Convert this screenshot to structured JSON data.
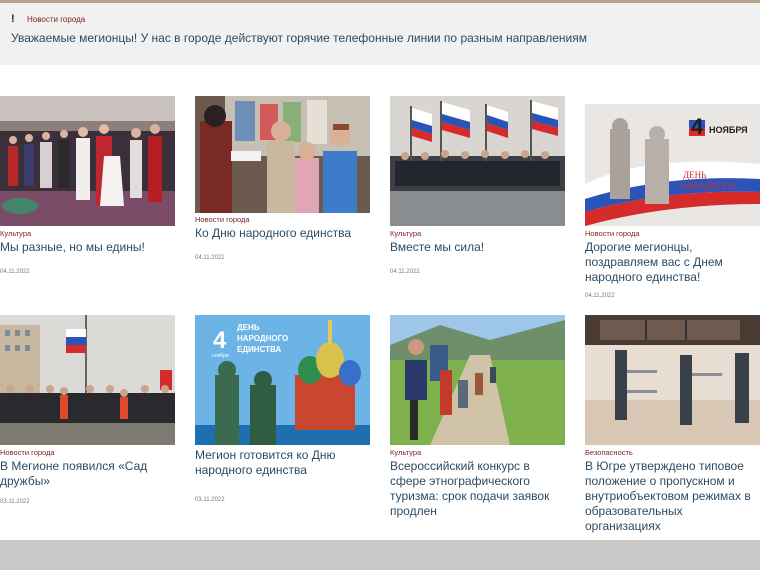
{
  "alert": {
    "icon": "!",
    "category": "Новости города",
    "text": "Уважаемые мегионцы! У нас в городе действуют горячие телефонные линии по разным направлениям"
  },
  "cards": [
    {
      "category": "Культура",
      "title": "Мы разные, но мы едины!",
      "date": "04.11.2022",
      "image": "dance-hall-photo"
    },
    {
      "category": "Новости города",
      "title": "Ко Дню народного единства",
      "date": "04.11.2022",
      "image": "family-award-photo"
    },
    {
      "category": "Культура",
      "title": "Вместе мы сила!",
      "date": "04.11.2022",
      "image": "flags-rally-photo"
    },
    {
      "category": "Новости города",
      "title": "Дорогие мегионцы, поздравляем вас с Днем народного единства!",
      "date": "04.11.2022",
      "image": "unity-day-poster"
    },
    {
      "category": "Новости города",
      "title": "В Мегионе появился «Сад дружбы»",
      "date": "03.11.2022",
      "image": "flag-ceremony-photo"
    },
    {
      "category": "",
      "title": "Мегион готовится ко Дню народного единства",
      "date": "03.11.2022",
      "image": "cathedral-poster"
    },
    {
      "category": "Культура",
      "title": "Всероссийский конкурс в сфере этнографического туризма: срок подачи заявок продлен",
      "date": "",
      "image": "hikers-photo"
    },
    {
      "category": "Безопасность",
      "title": "В Югре утверждено типовое положение о пропускном и внутриобъектовом режимах в образовательных организациях",
      "date": "",
      "image": "turnstiles-photo"
    }
  ],
  "posters": {
    "unity_day": {
      "number": "4",
      "month": "НОЯБРЯ",
      "line1": "ДЕНЬ",
      "line2": "НАРОДНОГО",
      "line3": "ЕДИНСТВА"
    },
    "cathedral": {
      "number": "4",
      "month": "ноября",
      "line1": "ДЕНЬ",
      "line2": "НАРОДНОГО",
      "line3": "ЕДИНСТВА"
    }
  }
}
